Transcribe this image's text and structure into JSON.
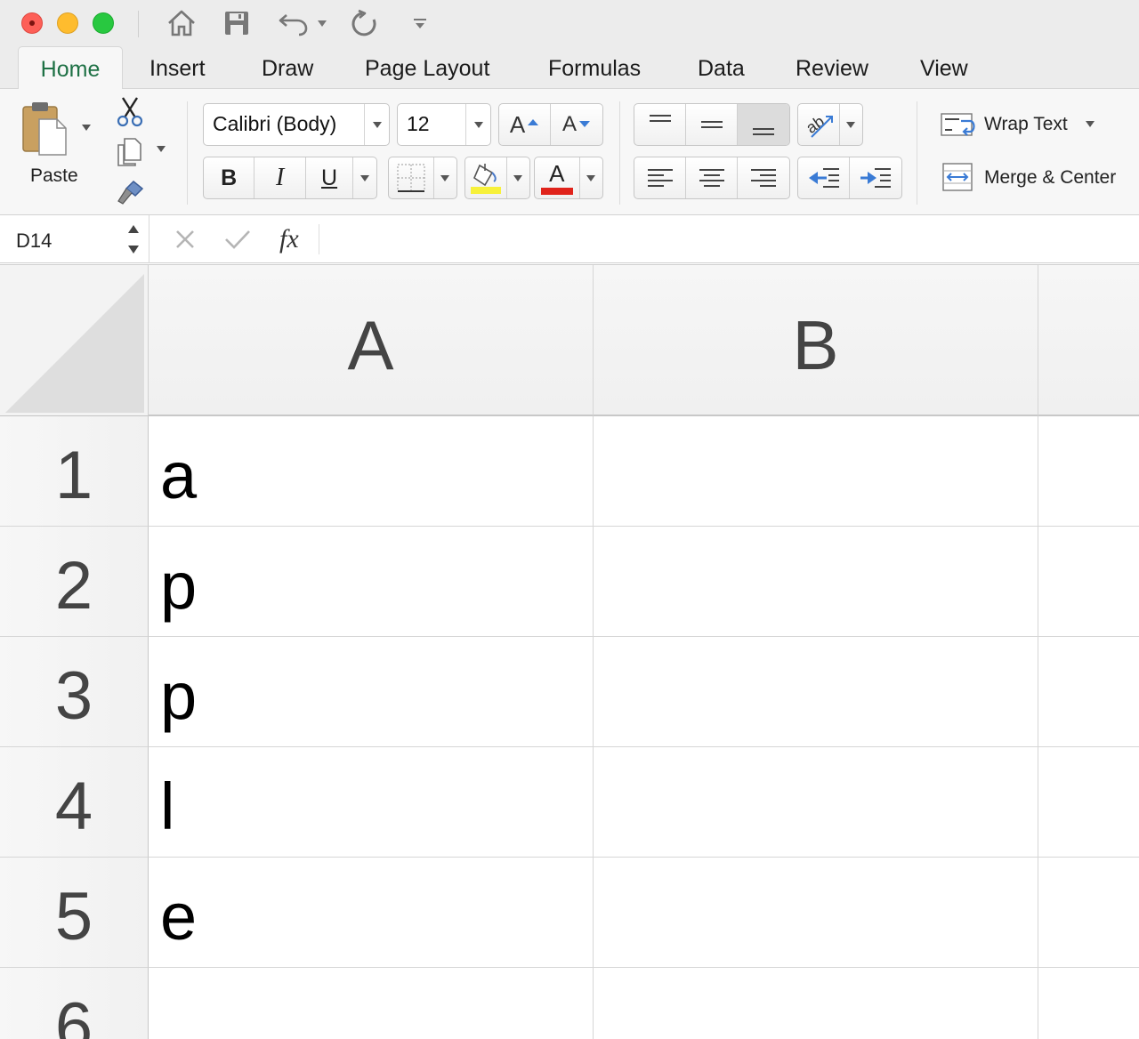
{
  "window": {
    "traffic_lights": [
      "close",
      "minimize",
      "zoom"
    ],
    "quick_access": [
      "home-icon",
      "save-icon",
      "undo-icon",
      "redo-icon",
      "customize-icon"
    ]
  },
  "tabs": [
    {
      "label": "Home",
      "active": true
    },
    {
      "label": "Insert"
    },
    {
      "label": "Draw"
    },
    {
      "label": "Page Layout"
    },
    {
      "label": "Formulas"
    },
    {
      "label": "Data"
    },
    {
      "label": "Review"
    },
    {
      "label": "View"
    }
  ],
  "ribbon": {
    "paste_label": "Paste",
    "font_name": "Calibri (Body)",
    "font_size": "12",
    "increase_font_label": "A",
    "decrease_font_label": "A",
    "bold_label": "B",
    "italic_label": "I",
    "underline_label": "U",
    "font_color_label": "A",
    "wrap_text_label": "Wrap Text",
    "merge_center_label": "Merge & Center",
    "highlight_color": "#f7f13a",
    "font_color": "#e0231b"
  },
  "formula_bar": {
    "name_box": "D14",
    "fx_label": "fx",
    "content": ""
  },
  "sheet": {
    "columns": [
      "A",
      "B"
    ],
    "rows": [
      {
        "num": "1",
        "A": "a",
        "B": ""
      },
      {
        "num": "2",
        "A": "p",
        "B": ""
      },
      {
        "num": "3",
        "A": "p",
        "B": ""
      },
      {
        "num": "4",
        "A": "l",
        "B": ""
      },
      {
        "num": "5",
        "A": "e",
        "B": ""
      },
      {
        "num": "6",
        "A": "",
        "B": ""
      }
    ]
  }
}
